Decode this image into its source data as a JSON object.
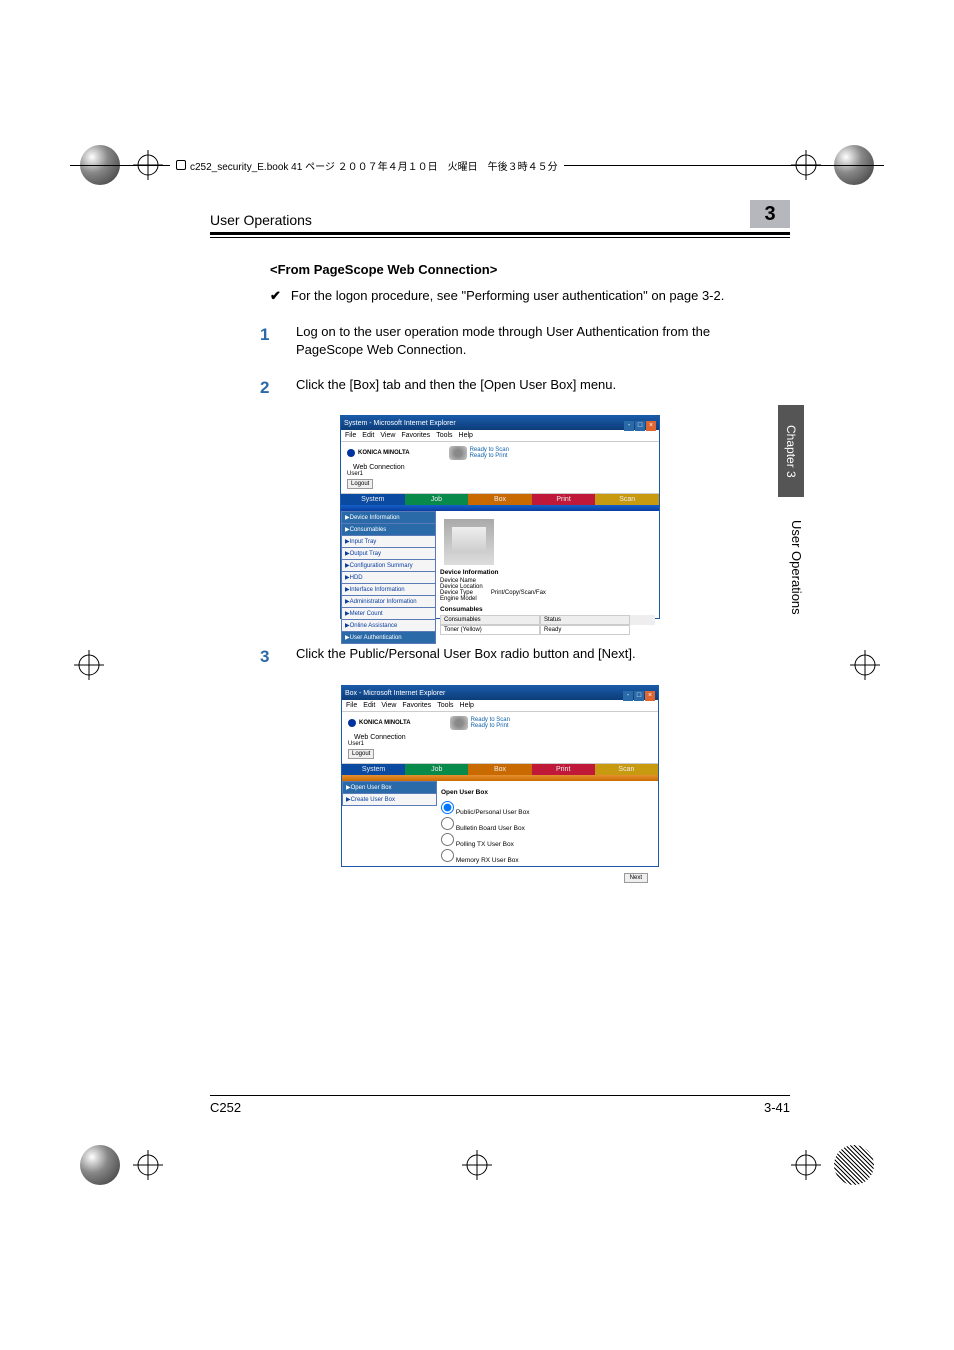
{
  "crop_header": "c252_security_E.book  41 ページ  ２００７年４月１０日　火曜日　午後３時４５分",
  "running_head": "User Operations",
  "chapter_num": "3",
  "subhead": "<From PageScope Web Connection>",
  "tick": {
    "mark": "✔",
    "text": "For the logon procedure, see \"Performing user authentication\" on page 3-2."
  },
  "steps": {
    "s1": {
      "num": "1",
      "text": "Log on to the user operation mode through User Authentication from the PageScope Web Connection."
    },
    "s2": {
      "num": "2",
      "text": "Click the [Box] tab and then the [Open User Box] menu."
    },
    "s3": {
      "num": "3",
      "text": "Click the Public/Personal User Box radio button and [Next]."
    }
  },
  "side_tab": "Chapter 3",
  "side_text": "User Operations",
  "footer": {
    "left": "C252",
    "right": "3-41"
  },
  "screenshot1": {
    "title": "System - Microsoft Internet Explorer",
    "menus": [
      "File",
      "Edit",
      "View",
      "Favorites",
      "Tools",
      "Help"
    ],
    "brand": "KONICA MINOLTA",
    "pswc": "Web Connection",
    "ready1": "Ready to Scan",
    "ready2": "Ready to Print",
    "user_label": "User1",
    "logout": "Logout",
    "tabs": {
      "system": "System",
      "job": "Job",
      "box": "Box",
      "print": "Print",
      "scan": "Scan"
    },
    "menu_items": [
      "▶Device Information",
      "▶Consumables",
      "▶Input Tray",
      "▶Output Tray",
      "▶Configuration Summary",
      "▶HDD",
      "▶Interface Information",
      "▶Administrator Information",
      "▶Meter Count",
      "▶Online Assistance",
      "▶User Authentication"
    ],
    "devinfo_h": "Device Information",
    "devinfo": {
      "k1": "Device Name",
      "v1": "",
      "k2": "Device Location",
      "v2": "",
      "k3": "Device Type",
      "v3": "Print/Copy/Scan/Fax",
      "k4": "Engine Model",
      "v4": ""
    },
    "consum_h": "Consumables",
    "consum_cols": {
      "c1": "Consumables",
      "c2": "Status"
    },
    "consum_row": {
      "c1": "Toner (Yellow)",
      "c2": "Ready"
    }
  },
  "screenshot2": {
    "title": "Box - Microsoft Internet Explorer",
    "menus": [
      "File",
      "Edit",
      "View",
      "Favorites",
      "Tools",
      "Help"
    ],
    "brand": "KONICA MINOLTA",
    "pswc": "Web Connection",
    "ready1": "Ready to Scan",
    "ready2": "Ready to Print",
    "user_label": "User1",
    "logout": "Logout",
    "tabs": {
      "system": "System",
      "job": "Job",
      "box": "Box",
      "print": "Print",
      "scan": "Scan"
    },
    "menu_items": [
      "▶Open User Box",
      "▶Create User Box"
    ],
    "panel_h": "Open User Box",
    "opts": {
      "o1": "Public/Personal User Box",
      "o2": "Bulletin Board User Box",
      "o3": "Polling TX User Box",
      "o4": "Memory RX User Box"
    },
    "next": "Next"
  }
}
